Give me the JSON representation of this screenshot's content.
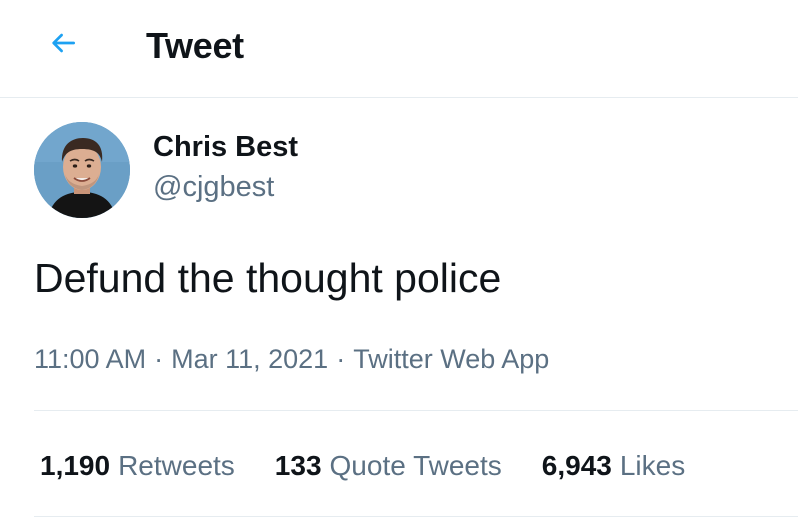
{
  "header": {
    "title": "Tweet",
    "back_icon": "arrow-left-icon",
    "accent_color": "#1da1f2"
  },
  "author": {
    "display_name": "Chris Best",
    "handle": "@cjgbest",
    "avatar": "avatar-photo"
  },
  "tweet": {
    "text": "Defund the thought police",
    "time": "11:00 AM",
    "date": "Mar 11, 2021",
    "source": "Twitter Web App",
    "separator": "·"
  },
  "stats": {
    "retweets_count": "1,190",
    "retweets_label": "Retweets",
    "quote_tweets_count": "133",
    "quote_tweets_label": "Quote Tweets",
    "likes_count": "6,943",
    "likes_label": "Likes"
  }
}
